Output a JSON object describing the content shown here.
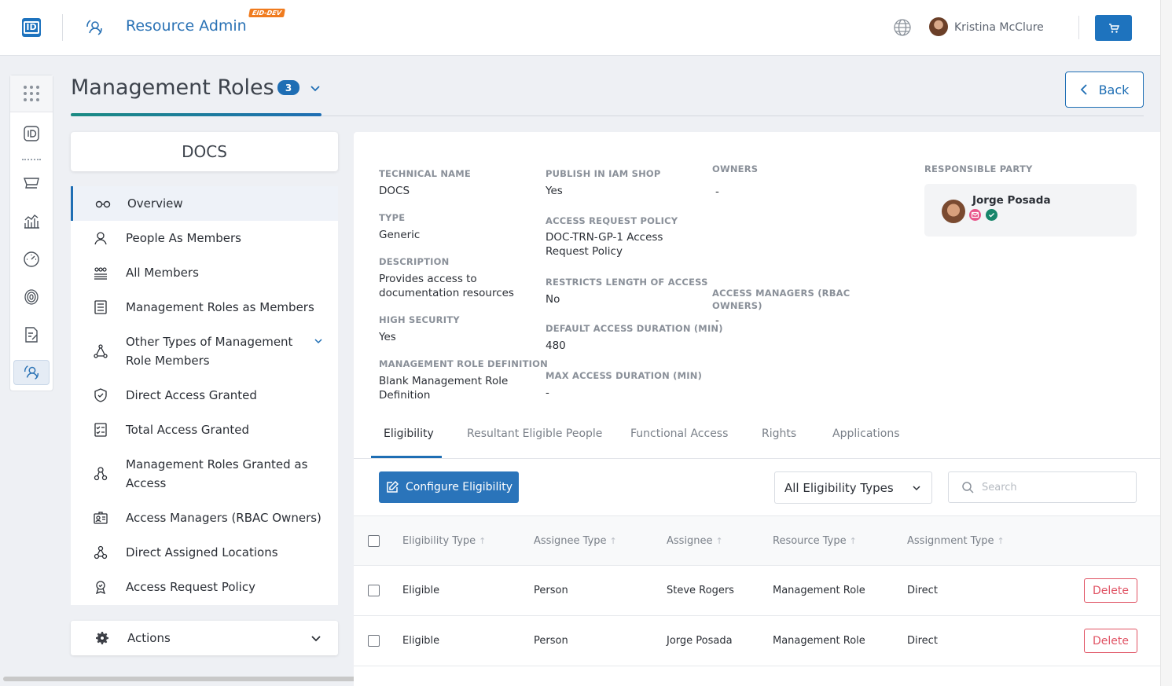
{
  "header": {
    "logo_text": "ID",
    "app_title": "Resource Admin",
    "env_badge": "EID-DEV",
    "user_name": "Kristina McClure"
  },
  "page": {
    "title": "Management Roles",
    "count": "3",
    "back_label": "Back"
  },
  "resource": {
    "name": "DOCS"
  },
  "nav": {
    "items": [
      {
        "label": "Overview",
        "icon": "glasses-icon"
      },
      {
        "label": "People As Members",
        "icon": "person-icon"
      },
      {
        "label": "All Members",
        "icon": "group-icon"
      },
      {
        "label": "Management Roles as Members",
        "icon": "list-icon"
      },
      {
        "label": "Other Types of Management Role Members",
        "icon": "network-icon"
      },
      {
        "label": "Direct Access Granted",
        "icon": "shield-check-icon"
      },
      {
        "label": "Total Access Granted",
        "icon": "checklist-icon"
      },
      {
        "label": "Management Roles Granted as Access",
        "icon": "role-tree-icon"
      },
      {
        "label": "Access Managers (RBAC Owners)",
        "icon": "id-card-icon"
      },
      {
        "label": "Direct Assigned Locations",
        "icon": "locations-icon"
      },
      {
        "label": "Access Request Policy",
        "icon": "policy-icon"
      }
    ],
    "actions_label": "Actions"
  },
  "details": {
    "technical_name_label": "TECHNICAL NAME",
    "technical_name": "DOCS",
    "type_label": "TYPE",
    "type": "Generic",
    "description_label": "DESCRIPTION",
    "description": "Provides access to documentation resources",
    "high_security_label": "HIGH SECURITY",
    "high_security": "Yes",
    "mrd_label": "MANAGEMENT ROLE DEFINITION",
    "mrd": "Blank Management Role Definition",
    "publish_label": "PUBLISH IN IAM SHOP",
    "publish": "Yes",
    "arp_label": "ACCESS REQUEST POLICY",
    "arp": "DOC-TRN-GP-1 Access Request Policy",
    "restricts_label": "RESTRICTS LENGTH OF ACCESS",
    "restricts": "No",
    "default_duration_label": "DEFAULT ACCESS DURATION (MIN)",
    "default_duration": "480",
    "max_duration_label": "MAX ACCESS DURATION (MIN)",
    "max_duration": "-",
    "owners_label": "OWNERS",
    "owners": "-",
    "access_managers_label": "ACCESS MANAGERS (RBAC OWNERS)",
    "access_managers": "-",
    "responsible_label": "RESPONSIBLE PARTY",
    "responsible_name": "Jorge Posada"
  },
  "tabs": [
    "Eligibility",
    "Resultant Eligible People",
    "Functional Access",
    "Rights",
    "Applications"
  ],
  "toolbar": {
    "configure_label": "Configure Eligibility",
    "filter_value": "All Eligibility Types",
    "search_placeholder": "Search"
  },
  "table": {
    "headers": [
      "Eligibility Type",
      "Assignee Type",
      "Assignee",
      "Resource Type",
      "Assignment Type"
    ],
    "sort_glyph": "↑",
    "rows": [
      {
        "eligibility_type": "Eligible",
        "assignee_type": "Person",
        "assignee": "Steve Rogers",
        "resource_type": "Management Role",
        "assignment_type": "Direct",
        "action": "Delete"
      },
      {
        "eligibility_type": "Eligible",
        "assignee_type": "Person",
        "assignee": "Jorge Posada",
        "resource_type": "Management Role",
        "assignment_type": "Direct",
        "action": "Delete"
      }
    ]
  },
  "colors": {
    "primary": "#1e73be",
    "danger": "#e05263",
    "env_badge": "#f07b1e"
  }
}
